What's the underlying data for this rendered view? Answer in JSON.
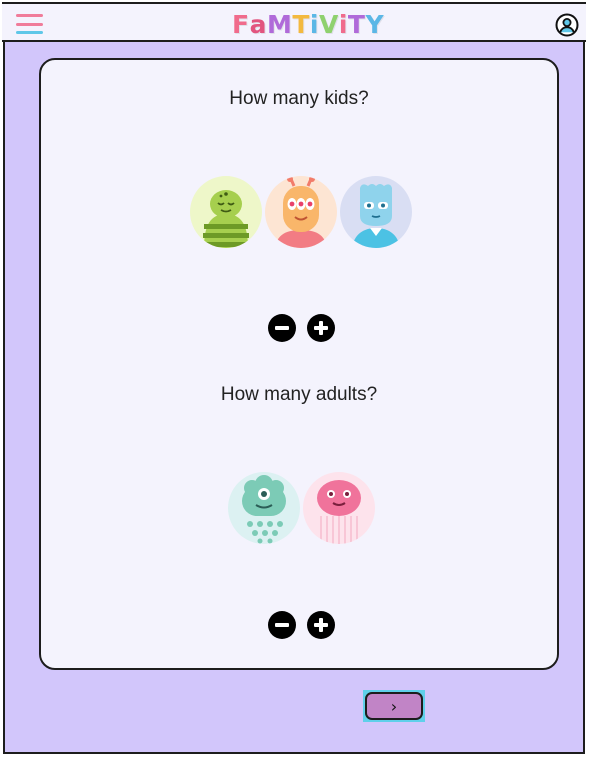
{
  "app": {
    "logo_letters": [
      "F",
      "a",
      "M",
      "T",
      "i",
      "V",
      "i",
      "T",
      "Y"
    ],
    "logo_colors": [
      "#f06b8c",
      "#e2557f",
      "#b06ad9",
      "#f3b93f",
      "#5bb7e6",
      "#8fd16e",
      "#f06b8c",
      "#b06ad9",
      "#5bb7e6"
    ]
  },
  "header": {
    "menu_icon": "hamburger-menu-icon",
    "account_icon": "user-account-icon",
    "menu_colors": [
      "#f07c9a",
      "#f07c9a",
      "#5fc7e8"
    ]
  },
  "kids_section": {
    "question": "How many kids?",
    "avatars": [
      "green-striped-monster",
      "orange-antenna-monster",
      "blue-cat-monster"
    ],
    "minus_icon": "minus-circle-icon",
    "plus_icon": "plus-circle-icon"
  },
  "adults_section": {
    "question": "How many adults?",
    "avatars": [
      "teal-cyclops-monster",
      "pink-jelly-monster"
    ],
    "minus_icon": "minus-circle-icon",
    "plus_icon": "plus-circle-icon"
  },
  "footer": {
    "next_label": "›",
    "next_icon": "chevron-right-icon"
  },
  "colors": {
    "background": "#d2c6fb",
    "card": "#f4f3fd",
    "next_button": "#c184c6",
    "next_highlight": "#5fd0ea"
  }
}
